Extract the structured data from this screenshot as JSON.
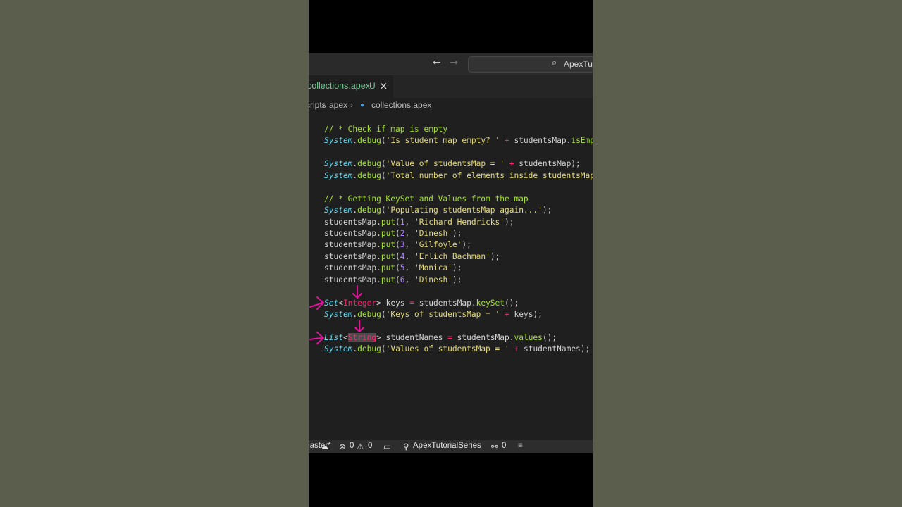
{
  "titlebar": {
    "back_icon": "arrow-left-icon",
    "forward_icon": "arrow-right-icon",
    "search_text": "ApexTutorialSeries"
  },
  "tab": {
    "filename": "collections.apex",
    "status": "U"
  },
  "breadcrumb": {
    "items": [
      "scripts",
      "apex",
      "collections.apex"
    ]
  },
  "code_lines": [
    "// * Check if map is empty",
    "System.debug('Is student map empty? ' + studentsMap.isEmpty());",
    "",
    "System.debug('Value of studentsMap = ' + studentsMap);",
    "System.debug('Total number of elements inside studentsMap = ' + studentsMap.size());",
    "",
    "// * Getting KeySet and Values from the map",
    "System.debug('Populating studentsMap again...');",
    "studentsMap.put(1, 'Richard Hendricks');",
    "studentsMap.put(2, 'Dinesh');",
    "studentsMap.put(3, 'Gilfoyle');",
    "studentsMap.put(4, 'Erlich Bachman');",
    "studentsMap.put(5, 'Monica');",
    "studentsMap.put(6, 'Dinesh');",
    "",
    "Set<Integer> keys = studentsMap.keySet();",
    "System.debug('Keys of studentsMap = ' + keys);",
    "",
    "List<String> studentNames = studentsMap.values();",
    "System.debug('Values of studentsMap = ' + studentNames);"
  ],
  "statusbar": {
    "branch": "master*",
    "errors": "0",
    "warnings": "0",
    "project": "ApexTutorialSeries",
    "ports": "0"
  },
  "colors": {
    "comment": "#a6e22e",
    "class": "#66d9ef",
    "string": "#e6db74",
    "number": "#ae81ff",
    "operator": "#f92672",
    "annotation": "#e0139a"
  }
}
